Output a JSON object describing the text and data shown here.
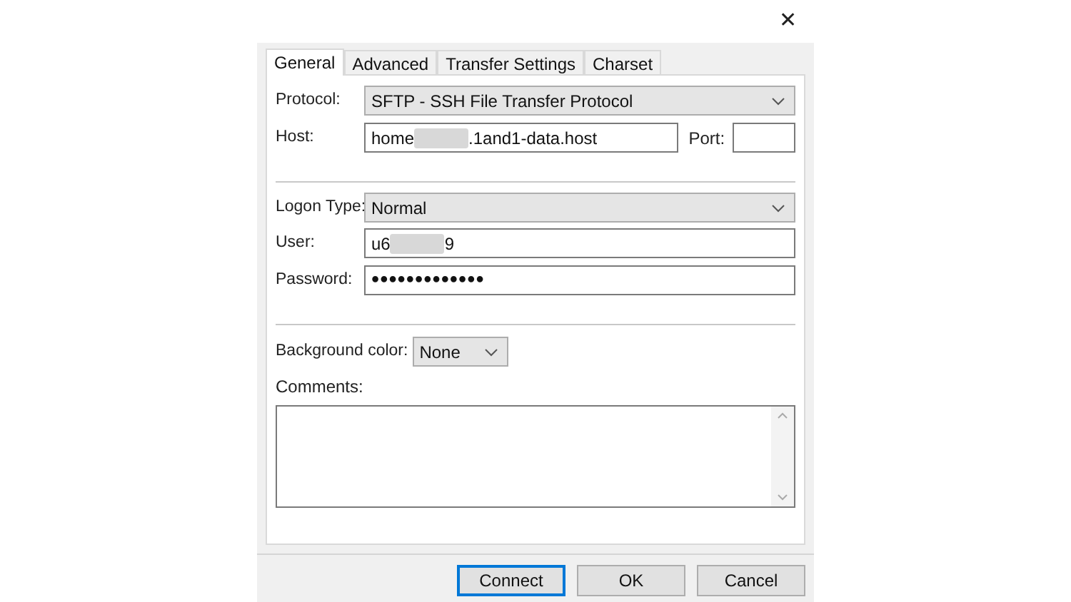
{
  "window": {
    "close": "✕"
  },
  "tabs": [
    {
      "label": "General",
      "selected": true
    },
    {
      "label": "Advanced",
      "selected": false
    },
    {
      "label": "Transfer Settings",
      "selected": false
    },
    {
      "label": "Charset",
      "selected": false
    }
  ],
  "protocol": {
    "label": "Protocol:",
    "value": "SFTP - SSH File Transfer Protocol"
  },
  "host": {
    "label": "Host:",
    "value_start": "home",
    "value_end": ".1and1-data.host",
    "redacted": true
  },
  "port": {
    "label": "Port:"
  },
  "logon_type": {
    "label": "Logon Type:",
    "value": "Normal"
  },
  "user": {
    "label": "User:",
    "value_start": "u6",
    "value_end": "9",
    "redacted": true
  },
  "password": {
    "label": "Password:",
    "value": "•••••••••••••"
  },
  "background_color": {
    "label": "Background color:",
    "value": "None"
  },
  "comments": {
    "label": "Comments:"
  },
  "buttons": [
    {
      "label": "Connect",
      "default": true
    },
    {
      "label": "OK",
      "default": false
    },
    {
      "label": "Cancel",
      "default": false
    }
  ]
}
